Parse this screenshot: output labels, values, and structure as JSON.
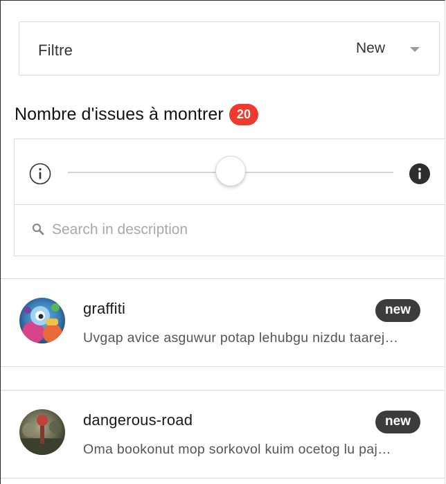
{
  "filter": {
    "label": "Filtre",
    "selected": "New"
  },
  "count_section": {
    "heading": "Nombre d'issues à montrer",
    "badge": "20"
  },
  "slider": {
    "value_fraction": 0.5
  },
  "search": {
    "placeholder": "Search in description",
    "value": ""
  },
  "issues": [
    {
      "title": "graffiti",
      "status": "new",
      "description": "Uvgap avice asguwur potap lehubgu nizdu taarej…"
    },
    {
      "title": "dangerous-road",
      "status": "new",
      "description": "Oma bookonut mop sorkovol kuim ocetog lu paj…"
    }
  ],
  "colors": {
    "count_badge": "#ef3b2d",
    "status_badge": "#3c3c3c",
    "border": "#dcdcdc"
  },
  "icons": {
    "filter_caret": "chevron-down-icon",
    "slider_min": "info-outline-icon",
    "slider_max": "info-solid-icon",
    "search": "search-icon"
  }
}
